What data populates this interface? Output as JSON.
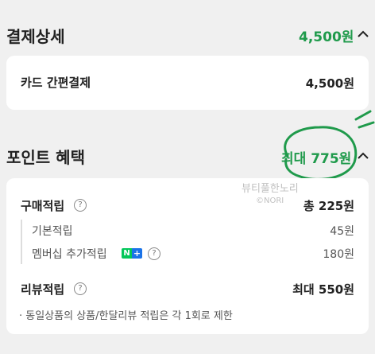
{
  "payment_detail": {
    "title": "결제상세",
    "amount": "4,500원",
    "row_label": "카드 간편결제",
    "row_value": "4,500원"
  },
  "point_benefit": {
    "title": "포인트 혜택",
    "amount": "최대 775원",
    "purchase": {
      "label": "구매적립",
      "value": "총 225원",
      "items": [
        {
          "label": "기본적립",
          "value": "45원"
        },
        {
          "label": "멤버십 추가적립",
          "value": "180원"
        }
      ]
    },
    "review": {
      "label": "리뷰적립",
      "value": "최대 550원"
    },
    "note": "· 동일상품의 상품/한달리뷰 적립은 각 1회로 제한"
  },
  "badge": {
    "n": "N",
    "plus": "+"
  },
  "help_glyph": "?",
  "watermark": {
    "line1": "뷰티풀한노리",
    "line2": "©NORI"
  },
  "colors": {
    "accent_green": "#1f9a4b",
    "naver_green": "#03c75a",
    "plus_blue": "#1a73e8",
    "background": "#f0f0f0",
    "card": "#ffffff"
  }
}
